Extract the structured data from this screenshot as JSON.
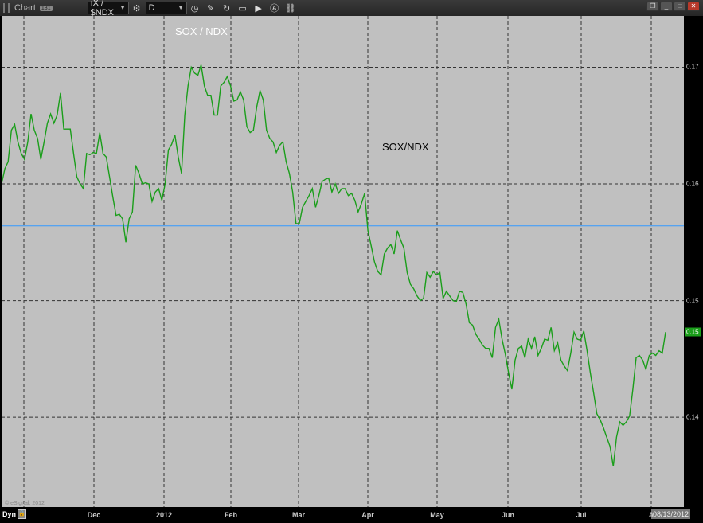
{
  "toolbar": {
    "title": "Chart",
    "badge": "131",
    "symbol": "ıX / $NDX",
    "interval": "D",
    "icons": [
      "settings-icon",
      "clock-icon",
      "pencil-icon",
      "refresh-icon",
      "template-icon",
      "play-icon",
      "alert-icon",
      "link-icon"
    ]
  },
  "window": {
    "buttons": [
      "restore",
      "minimize",
      "maximize",
      "close"
    ]
  },
  "footer": {
    "mode": "Dyn",
    "lock": "lock-icon",
    "date_label": "08/13/2012",
    "watermark": "© eSignal, 2012"
  },
  "colors": {
    "line": "#1a9e1a",
    "ref": "#3399ff",
    "bg": "#c0c0c0"
  },
  "chart_data": {
    "type": "line",
    "title": "SOX / NDX",
    "annotation": "SOX/NDX",
    "series": [
      {
        "name": "SOX/NDX",
        "values": [
          0.16,
          0.1613,
          0.1619,
          0.1646,
          0.1651,
          0.1636,
          0.1626,
          0.1621,
          0.1636,
          0.166,
          0.1646,
          0.1639,
          0.1621,
          0.1636,
          0.1652,
          0.166,
          0.1652,
          0.1659,
          0.1678,
          0.1647,
          0.1647,
          0.1647,
          0.1626,
          0.1606,
          0.16,
          0.1596,
          0.1626,
          0.1625,
          0.1627,
          0.1626,
          0.1644,
          0.1626,
          0.1623,
          0.1606,
          0.1589,
          0.1573,
          0.1574,
          0.157,
          0.155,
          0.157,
          0.1576,
          0.1616,
          0.1609,
          0.16,
          0.1601,
          0.16,
          0.1585,
          0.1593,
          0.1596,
          0.1586,
          0.16,
          0.1629,
          0.1634,
          0.1642,
          0.1623,
          0.1609,
          0.1659,
          0.1684,
          0.17,
          0.1695,
          0.1693,
          0.1702,
          0.1684,
          0.1676,
          0.1676,
          0.1659,
          0.1659,
          0.1684,
          0.1687,
          0.1692,
          0.1684,
          0.1671,
          0.1672,
          0.1679,
          0.1672,
          0.1649,
          0.1644,
          0.1646,
          0.1666,
          0.168,
          0.1672,
          0.1646,
          0.1639,
          0.1636,
          0.1627,
          0.1633,
          0.1636,
          0.1619,
          0.1609,
          0.1593,
          0.1566,
          0.1566,
          0.158,
          0.1585,
          0.159,
          0.1596,
          0.158,
          0.159,
          0.1602,
          0.1604,
          0.1605,
          0.1593,
          0.16,
          0.1592,
          0.1596,
          0.1596,
          0.159,
          0.1592,
          0.1586,
          0.1576,
          0.1583,
          0.1592,
          0.156,
          0.1547,
          0.1533,
          0.1525,
          0.1522,
          0.154,
          0.1545,
          0.1548,
          0.154,
          0.156,
          0.1552,
          0.1545,
          0.1524,
          0.1514,
          0.151,
          0.1504,
          0.15,
          0.1502,
          0.1524,
          0.152,
          0.1525,
          0.1522,
          0.1524,
          0.1502,
          0.1508,
          0.1504,
          0.15,
          0.1499,
          0.1508,
          0.1507,
          0.1497,
          0.1481,
          0.1479,
          0.1471,
          0.1467,
          0.1462,
          0.1459,
          0.1459,
          0.1451,
          0.1477,
          0.1484,
          0.1467,
          0.1454,
          0.1438,
          0.1424,
          0.1449,
          0.1459,
          0.1461,
          0.1451,
          0.1467,
          0.1459,
          0.1469,
          0.1453,
          0.1459,
          0.1467,
          0.1466,
          0.1477,
          0.1457,
          0.1464,
          0.1449,
          0.1444,
          0.144,
          0.1455,
          0.1473,
          0.1467,
          0.1466,
          0.1474,
          0.1457,
          0.1438,
          0.1421,
          0.1403,
          0.1398,
          0.1391,
          0.1383,
          0.1375,
          0.1358,
          0.1383,
          0.1396,
          0.1393,
          0.1396,
          0.1401,
          0.1424,
          0.1451,
          0.1453,
          0.1449,
          0.1441,
          0.1453,
          0.1455,
          0.1453,
          0.1457,
          0.1455,
          0.1473
        ]
      }
    ],
    "reference_line": 0.1564,
    "ylim": [
      0.1323,
      0.1744
    ],
    "yticks": [
      "0.17",
      "0.16",
      "0.15",
      "0.14"
    ],
    "ytick_values": [
      0.17,
      0.16,
      0.15,
      0.14
    ],
    "current_value_label": "0.15",
    "current_value": 0.1473,
    "xticks": [
      "",
      "Dec",
      "2012",
      "Feb",
      "Mar",
      "Apr",
      "May",
      "Jun",
      "Jul",
      "A"
    ],
    "grid": true
  }
}
